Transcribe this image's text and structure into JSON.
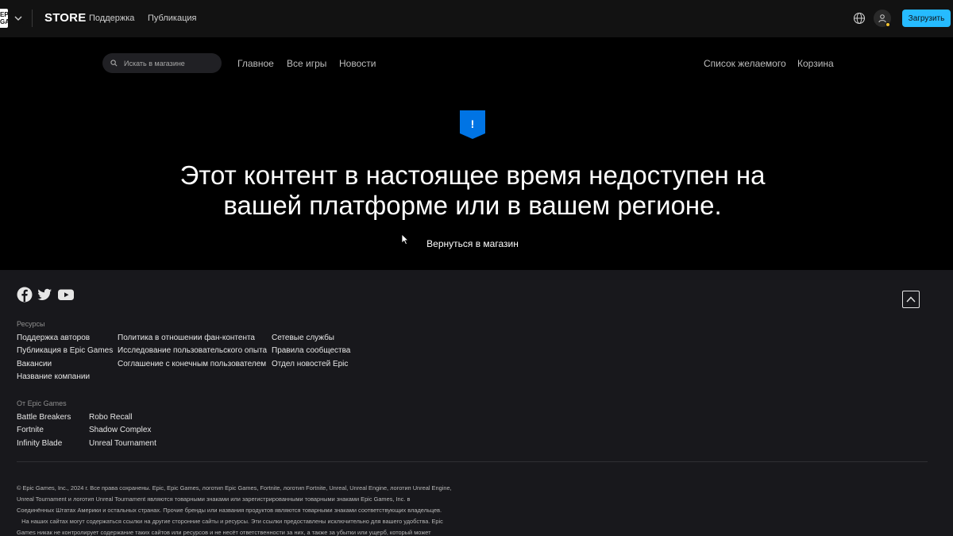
{
  "topbar": {
    "logo_text": "EPIC GAMES",
    "store_label": "STORE",
    "links": [
      "Поддержка",
      "Публикация"
    ],
    "download_label": "Загрузить",
    "icons": {
      "logo": "epic-games-logo",
      "chevron": "chevron-down-icon",
      "globe": "globe-icon",
      "user": "user-icon"
    }
  },
  "store_nav": {
    "search_placeholder": "Искать в магазине",
    "links": [
      "Главное",
      "Все игры",
      "Новости"
    ],
    "right_links": [
      "Список желаемого",
      "Корзина"
    ]
  },
  "message": {
    "headline_line1": "Этот контент в настоящее время недоступен на",
    "headline_line2": "вашей платформе или в вашем регионе.",
    "back_label": "Вернуться в магазин",
    "badge_symbol": "!"
  },
  "footer": {
    "social": [
      "facebook-icon",
      "twitter-icon",
      "youtube-icon"
    ],
    "resources_title": "Ресурсы",
    "resources_col1": [
      "Поддержка авторов",
      "Публикация в Epic Games",
      "Вакансии",
      "Название компании"
    ],
    "resources_col2": [
      "Политика в отношении фан-контента",
      "Исследование пользовательского опыта",
      "Соглашение с конечным пользователем"
    ],
    "resources_col3": [
      "Сетевые службы",
      "Правила сообщества",
      "Отдел новостей Epic"
    ],
    "games_title": "От Epic Games",
    "games_col1": [
      "Battle Breakers",
      "Fortnite",
      "Infinity Blade"
    ],
    "games_col2": [
      "Robo Recall",
      "Shadow Complex",
      "Unreal Tournament"
    ],
    "legal_lines": [
      "© Epic Games, Inc., 2024 г. Все права сохранены. Epic, Epic Games, логотип Epic Games, Fortnite, логотип Fortnite, Unreal, Unreal Engine, логотип Unreal Engine,",
      "Unreal Tournament и логотип Unreal Tournament являются товарными знаками или зарегистрированными товарными знаками Epic Games, Inc. в",
      "Соединённых Штатах Америки и остальных странах. Прочие бренды или названия продуктов являются товарными знаками соответствующих владельцев.",
      "   На наших сайтах могут содержаться ссылки на другие сторонние сайты и ресурсы. Эти ссылки предоставлены исключительно для вашего удобства. Epic",
      "Games никак не контролирует содержание таких сайтов или ресурсов и не несёт ответственности за них, а также за убытки или ущерб, который может"
    ]
  },
  "colors": {
    "accent": "#26bbff",
    "badge": "#0074e4",
    "topbar_bg": "#121212",
    "footer_bg": "#18181c"
  }
}
